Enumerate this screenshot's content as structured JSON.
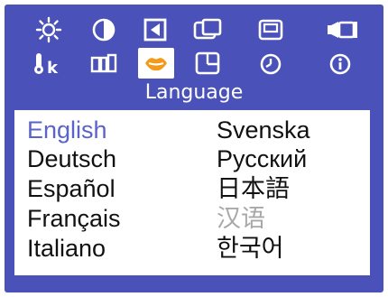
{
  "osd": {
    "background": "#4a52b9",
    "accent": "#5a63c7",
    "selected_icon_color": "#f29a1a",
    "icons_row1": [
      "brightness-icon",
      "contrast-icon",
      "position-icon",
      "size-icon",
      "osd-position-icon",
      "recall-icon"
    ],
    "icons_row2": [
      "color-temperature-icon",
      "geometry-icon",
      "language-icon",
      "zoom-icon",
      "clock-icon",
      "information-icon"
    ],
    "selected_icon": "language-icon"
  },
  "section": {
    "title": "Language"
  },
  "languages": {
    "left": [
      "English",
      "Deutsch",
      "Español",
      "Français",
      "Italiano"
    ],
    "right": [
      "Svenska",
      "Русский",
      "日本語",
      "汉语",
      "한국어"
    ],
    "selected": "English",
    "disabled": "汉语"
  }
}
